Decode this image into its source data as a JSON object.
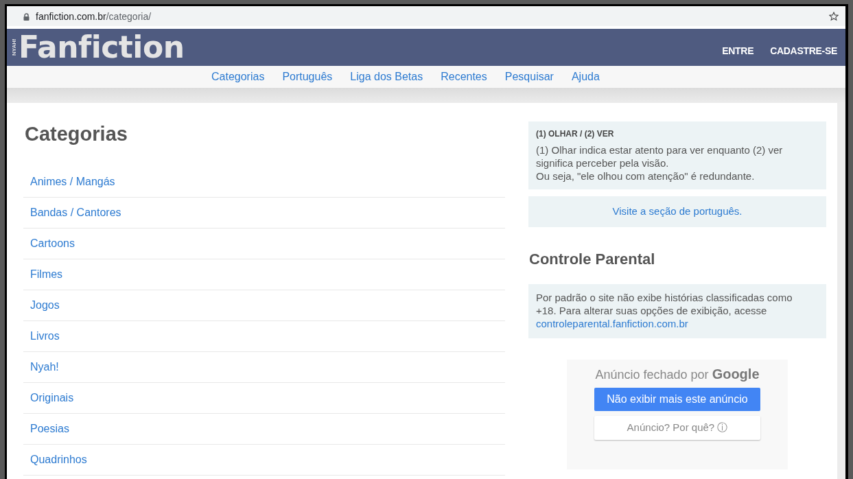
{
  "browser": {
    "url_host": "fanfiction.com.br",
    "url_path": "/categoria/"
  },
  "header": {
    "logo_tag": "NYAH!",
    "logo": "Fanfiction",
    "actions": [
      "ENTRE",
      "CADASTRE-SE"
    ]
  },
  "nav": [
    "Categorias",
    "Português",
    "Liga dos Betas",
    "Recentes",
    "Pesquisar",
    "Ajuda"
  ],
  "main": {
    "title": "Categorias",
    "categories": [
      "Animes / Mangás",
      "Bandas / Cantores",
      "Cartoons",
      "Filmes",
      "Jogos",
      "Livros",
      "Nyah!",
      "Originais",
      "Poesias",
      "Quadrinhos"
    ]
  },
  "sidebar": {
    "tip": {
      "title": "(1) OLHAR / (2) VER",
      "lines": [
        "(1) Olhar indica estar atento para ver enquanto (2) ver significa perceber pela visão.",
        "Ou seja, \"ele olhou com atenção\" é redundante."
      ]
    },
    "tip_link": "Visite a seção de português.",
    "parental": {
      "title": "Controle Parental",
      "text": "Por padrão o site não exibe histórias classificadas como +18. Para alterar suas opções de exibição, acesse",
      "link": "controleparental.fanfiction.com.br"
    },
    "ad": {
      "closed_text": "Anúncio fechado por",
      "brand": "Google",
      "primary_button": "Não exibir mais este anúncio",
      "secondary_button": "Anúncio? Por quê? ⓘ"
    }
  }
}
